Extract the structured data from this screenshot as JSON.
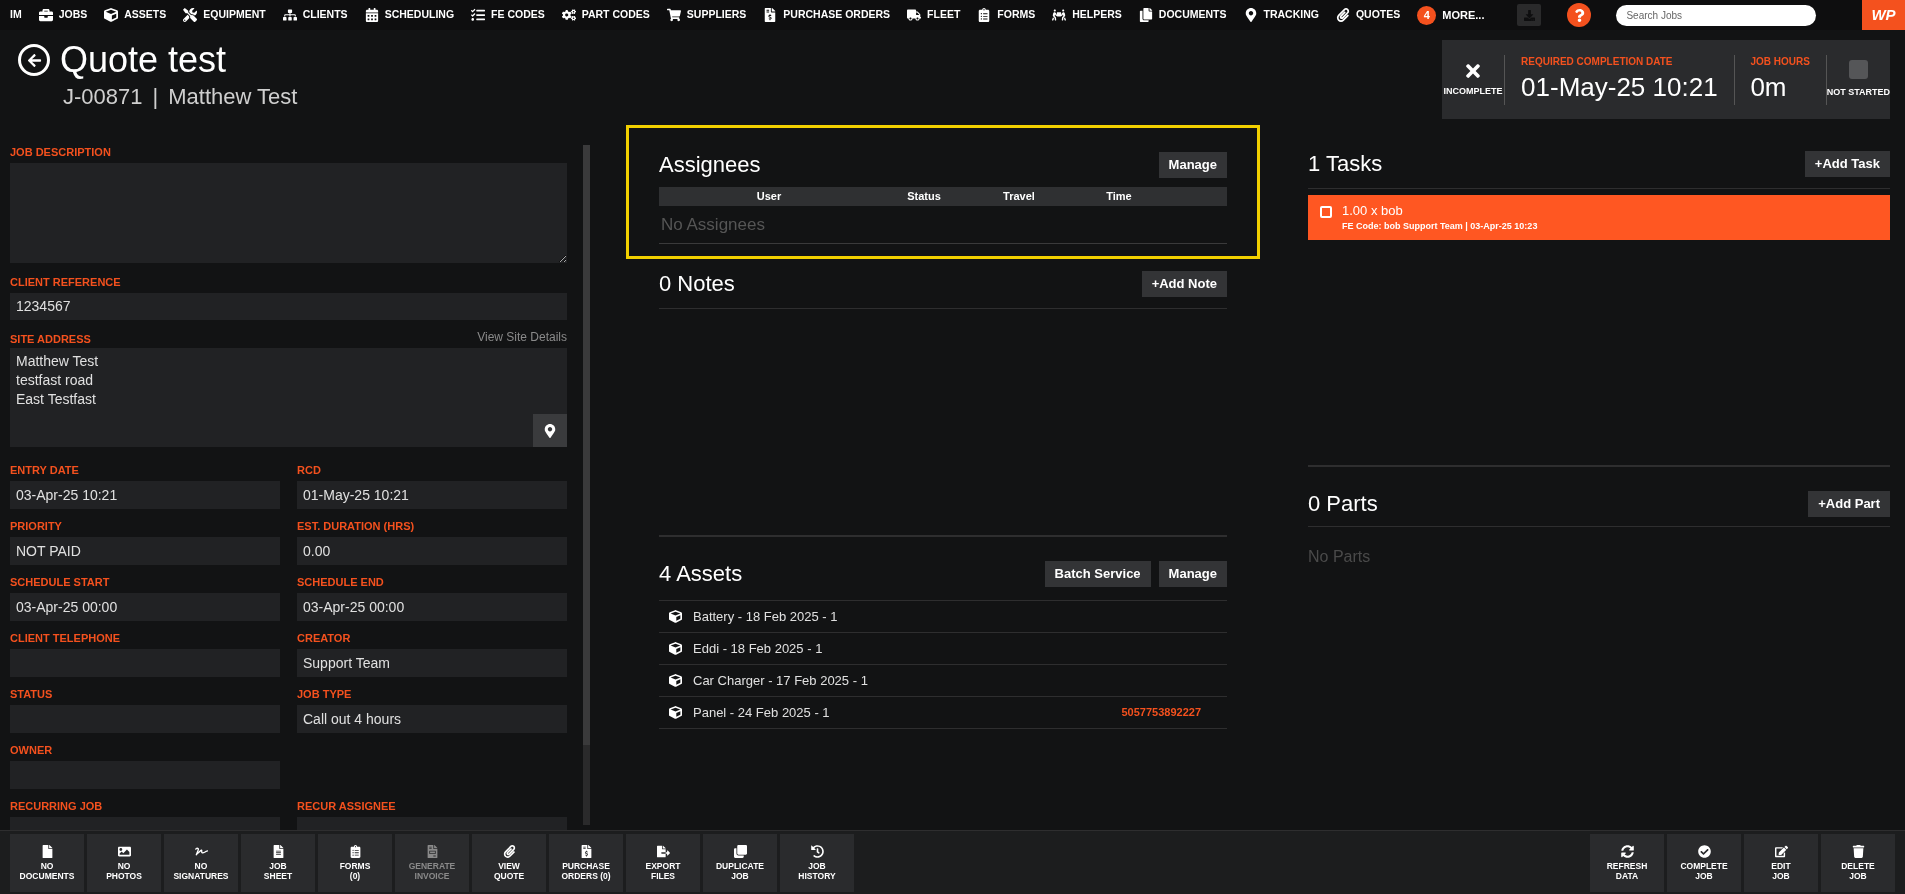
{
  "nav": {
    "items": [
      {
        "label": "IM"
      },
      {
        "label": "JOBS"
      },
      {
        "label": "ASSETS"
      },
      {
        "label": "EQUIPMENT"
      },
      {
        "label": "CLIENTS"
      },
      {
        "label": "SCHEDULING"
      },
      {
        "label": "FE CODES"
      },
      {
        "label": "PART CODES"
      },
      {
        "label": "SUPPLIERS"
      },
      {
        "label": "PURCHASE ORDERS"
      },
      {
        "label": "FLEET"
      },
      {
        "label": "FORMS"
      },
      {
        "label": "HELPERS"
      },
      {
        "label": "DOCUMENTS"
      },
      {
        "label": "TRACKING"
      },
      {
        "label": "QUOTES"
      }
    ],
    "more": {
      "badge": "4",
      "label": "MORE..."
    },
    "search": {
      "placeholder": "Search Jobs"
    },
    "logo": "WP"
  },
  "header": {
    "title": "Quote test",
    "job_number": "J-00871",
    "separator": "|",
    "client": "Matthew Test"
  },
  "status_panel": {
    "state": "INCOMPLETE",
    "rcd_label": "REQUIRED COMPLETION DATE",
    "rcd": "01-May-25 10:21",
    "hours_label": "JOB HOURS",
    "hours": "0m",
    "started_label": "NOT STARTED",
    "started": false
  },
  "details": {
    "job_description": {
      "label": "JOB DESCRIPTION"
    },
    "client_reference": {
      "label": "CLIENT REFERENCE",
      "value": "1234567"
    },
    "site_address": {
      "label": "SITE ADDRESS",
      "link": "View Site Details",
      "lines": [
        "Matthew Test",
        "testfast road",
        "East Testfast"
      ]
    },
    "rows": [
      {
        "left": {
          "label": "ENTRY DATE",
          "value": "03-Apr-25 10:21"
        },
        "right": {
          "label": "RCD",
          "value": "01-May-25 10:21"
        }
      },
      {
        "left": {
          "label": "PRIORITY",
          "value": "NOT PAID"
        },
        "right": {
          "label": "EST. DURATION (HRS)",
          "value": "0.00"
        }
      },
      {
        "left": {
          "label": "SCHEDULE START",
          "value": "03-Apr-25 00:00"
        },
        "right": {
          "label": "SCHEDULE END",
          "value": "03-Apr-25 00:00"
        }
      },
      {
        "left": {
          "label": "CLIENT TELEPHONE"
        },
        "right": {
          "label": "CREATOR",
          "value": "Support Team"
        }
      },
      {
        "left": {
          "label": "STATUS"
        },
        "right": {
          "label": "JOB TYPE",
          "value": "Call out 4 hours"
        }
      },
      {
        "left": {
          "label": "OWNER"
        }
      },
      {
        "left": {
          "label": "RECURRING JOB"
        },
        "right": {
          "label": "RECUR ASSIGNEE"
        }
      }
    ]
  },
  "assignees": {
    "title": "Assignees",
    "highlighted": true,
    "manage": "Manage",
    "columns": [
      "User",
      "Status",
      "Travel",
      "Time"
    ],
    "empty": "No Assignees"
  },
  "notes": {
    "title": "0 Notes",
    "add": "+Add Note"
  },
  "assets": {
    "title": "4 Assets",
    "buttons": [
      "Batch Service",
      "Manage"
    ],
    "items": [
      {
        "label": "Battery - 18 Feb 2025 - 1"
      },
      {
        "label": "Eddi - 18 Feb 2025 - 1"
      },
      {
        "label": "Car Charger - 17 Feb 2025 - 1"
      },
      {
        "label": "Panel - 24 Feb 2025 - 1",
        "code": "5057753892227"
      }
    ]
  },
  "tasks": {
    "title": "1 Tasks",
    "add": "+Add Task",
    "items": [
      {
        "title": "1.00 x bob",
        "detail": "FE Code: bob Support Team | 03-Apr-25 10:23",
        "checked": false
      }
    ]
  },
  "parts": {
    "title": "0 Parts",
    "add": "+Add Part",
    "empty": "No Parts"
  },
  "toolbar": {
    "left": [
      {
        "label": "NO\nDOCUMENTS",
        "disabled": false
      },
      {
        "label": "NO\nPHOTOS",
        "disabled": false
      },
      {
        "label": "NO\nSIGNATURES",
        "disabled": false
      },
      {
        "label": "JOB\nSHEET",
        "disabled": false
      },
      {
        "label": "FORMS\n(0)",
        "disabled": false
      },
      {
        "label": "GENERATE\nINVOICE",
        "disabled": true
      },
      {
        "label": "VIEW\nQUOTE",
        "disabled": false
      },
      {
        "label": "PURCHASE\nORDERS (0)",
        "disabled": false
      },
      {
        "label": "EXPORT\nFILES",
        "disabled": false
      },
      {
        "label": "DUPLICATE\nJOB",
        "disabled": false
      },
      {
        "label": "JOB\nHISTORY",
        "disabled": false
      }
    ],
    "right": [
      {
        "label": "REFRESH\nDATA",
        "disabled": false
      },
      {
        "label": "COMPLETE\nJOB",
        "disabled": false
      },
      {
        "label": "EDIT\nJOB",
        "disabled": false
      },
      {
        "label": "DELETE\nJOB",
        "disabled": false
      }
    ]
  }
}
